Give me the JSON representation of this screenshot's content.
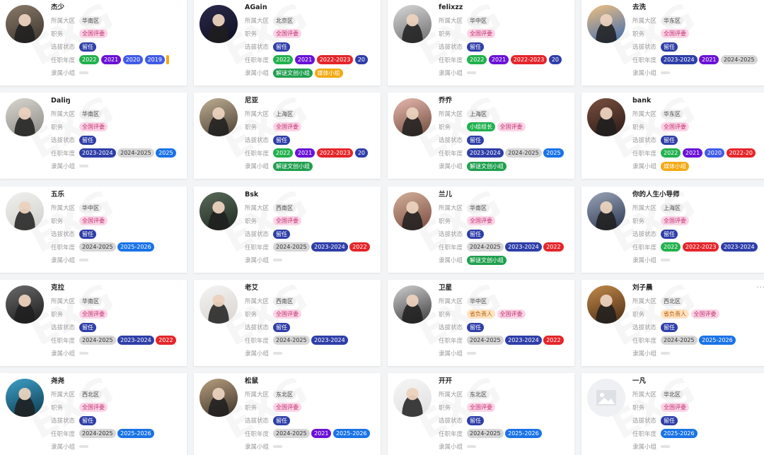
{
  "labels": {
    "region": "所属大区",
    "position": "职务",
    "status": "选拔状态",
    "years": "任职年度",
    "group": "隶属小组"
  },
  "colors": {
    "region": "#eeeeee",
    "position": "#fbd5e7",
    "status": "#2e3ea8",
    "green": "#22b14c",
    "purple": "#6a11d6",
    "red": "#e5252a",
    "blue": "#3f5be8",
    "gray": "#d6d6d6",
    "sky": "#1a73e8",
    "gold": "#f3a912"
  },
  "cards": [
    {
      "name": "杰少",
      "region": "华南区",
      "positions": [
        {
          "text": "全国评委",
          "style": "pos"
        }
      ],
      "status": "留任",
      "years": [
        {
          "text": "2022",
          "style": "green"
        },
        {
          "text": "2021",
          "style": "purple"
        },
        {
          "text": "2020",
          "style": "blue"
        },
        {
          "text": "2019",
          "style": "blue"
        },
        {
          "text": "",
          "style": "gold"
        }
      ],
      "groups": []
    },
    {
      "name": "AGain",
      "region": "北京区",
      "positions": [
        {
          "text": "全国评委",
          "style": "pos"
        }
      ],
      "status": "留任",
      "years": [
        {
          "text": "2022",
          "style": "green"
        },
        {
          "text": "2021",
          "style": "purple"
        },
        {
          "text": "2022-2023",
          "style": "red"
        },
        {
          "text": "20",
          "style": "navy"
        }
      ],
      "groups": [
        {
          "text": "解谜文创小组",
          "style": "dgreen"
        },
        {
          "text": "媒体小组",
          "style": "gold"
        }
      ]
    },
    {
      "name": "felixzz",
      "region": "华中区",
      "positions": [
        {
          "text": "全国评委",
          "style": "pos"
        }
      ],
      "status": "留任",
      "years": [
        {
          "text": "2022",
          "style": "green"
        },
        {
          "text": "2021",
          "style": "purple"
        },
        {
          "text": "2022-2023",
          "style": "red"
        },
        {
          "text": "20",
          "style": "navy"
        }
      ],
      "groups": []
    },
    {
      "name": "去洗",
      "region": "华东区",
      "positions": [
        {
          "text": "全国评委",
          "style": "pos"
        }
      ],
      "status": "留任",
      "years": [
        {
          "text": "2023-2024",
          "style": "navy"
        },
        {
          "text": "2021",
          "style": "purple"
        },
        {
          "text": "2024-2025",
          "style": "gray"
        }
      ],
      "groups": []
    },
    {
      "name": "Daliŋ",
      "region": "华南区",
      "positions": [
        {
          "text": "全国评委",
          "style": "pos"
        }
      ],
      "status": "留任",
      "years": [
        {
          "text": "2023-2024",
          "style": "navy"
        },
        {
          "text": "2024-2025",
          "style": "gray"
        },
        {
          "text": "2025",
          "style": "sky"
        }
      ],
      "groups": []
    },
    {
      "name": "尼亚",
      "region": "上海区",
      "positions": [
        {
          "text": "全国评委",
          "style": "pos"
        }
      ],
      "status": "留任",
      "years": [
        {
          "text": "2022",
          "style": "green"
        },
        {
          "text": "2021",
          "style": "purple"
        },
        {
          "text": "2022-2023",
          "style": "red"
        },
        {
          "text": "20",
          "style": "navy"
        }
      ],
      "groups": [
        {
          "text": "解谜文创小组",
          "style": "dgreen"
        }
      ]
    },
    {
      "name": "乔乔",
      "region": "上海区",
      "positions": [
        {
          "text": "小组组长",
          "style": "lead"
        },
        {
          "text": "全国评委",
          "style": "pos"
        }
      ],
      "status": "留任",
      "years": [
        {
          "text": "2023-2024",
          "style": "navy"
        },
        {
          "text": "2024-2025",
          "style": "gray"
        },
        {
          "text": "2025",
          "style": "sky"
        }
      ],
      "groups": [
        {
          "text": "解谜文创小组",
          "style": "dgreen"
        }
      ]
    },
    {
      "name": "bank",
      "region": "华东区",
      "positions": [
        {
          "text": "全国评委",
          "style": "pos"
        }
      ],
      "status": "留任",
      "years": [
        {
          "text": "2022",
          "style": "green"
        },
        {
          "text": "2021",
          "style": "purple"
        },
        {
          "text": "2020",
          "style": "blue"
        },
        {
          "text": "2022-20",
          "style": "red"
        }
      ],
      "groups": [
        {
          "text": "媒体小组",
          "style": "gold"
        }
      ]
    },
    {
      "name": "五乐",
      "region": "华中区",
      "positions": [
        {
          "text": "全国评委",
          "style": "pos"
        }
      ],
      "status": "留任",
      "years": [
        {
          "text": "2024-2025",
          "style": "gray"
        },
        {
          "text": "2025-2026",
          "style": "sky"
        }
      ],
      "groups": []
    },
    {
      "name": "Bsk",
      "region": "西南区",
      "positions": [
        {
          "text": "全国评委",
          "style": "pos"
        }
      ],
      "status": "留任",
      "years": [
        {
          "text": "2024-2025",
          "style": "gray"
        },
        {
          "text": "2023-2024",
          "style": "navy"
        },
        {
          "text": "2022",
          "style": "red"
        }
      ],
      "groups": []
    },
    {
      "name": "兰儿",
      "region": "华南区",
      "positions": [
        {
          "text": "全国评委",
          "style": "pos"
        }
      ],
      "status": "留任",
      "years": [
        {
          "text": "2024-2025",
          "style": "gray"
        },
        {
          "text": "2023-2024",
          "style": "navy"
        },
        {
          "text": "2022",
          "style": "red"
        }
      ],
      "groups": [
        {
          "text": "解谜文创小组",
          "style": "dgreen"
        }
      ]
    },
    {
      "name": "你的人生小导师",
      "region": "上海区",
      "positions": [
        {
          "text": "全国评委",
          "style": "pos"
        }
      ],
      "status": "留任",
      "years": [
        {
          "text": "2022",
          "style": "green"
        },
        {
          "text": "2022-2023",
          "style": "red"
        },
        {
          "text": "2023-2024",
          "style": "navy"
        }
      ],
      "groups": []
    },
    {
      "name": "克拉",
      "region": "华南区",
      "positions": [
        {
          "text": "全国评委",
          "style": "pos"
        }
      ],
      "status": "留任",
      "years": [
        {
          "text": "2024-2025",
          "style": "gray"
        },
        {
          "text": "2023-2024",
          "style": "navy"
        },
        {
          "text": "2022",
          "style": "red"
        }
      ],
      "groups": []
    },
    {
      "name": "老艾",
      "region": "西南区",
      "positions": [
        {
          "text": "全国评委",
          "style": "pos"
        }
      ],
      "status": "留任",
      "years": [
        {
          "text": "2024-2025",
          "style": "gray"
        },
        {
          "text": "2023-2024",
          "style": "navy"
        }
      ],
      "groups": []
    },
    {
      "name": "卫星",
      "region": "华中区",
      "positions": [
        {
          "text": "省负责人",
          "style": "pos2"
        },
        {
          "text": "全国评委",
          "style": "pos"
        }
      ],
      "status": "留任",
      "years": [
        {
          "text": "2024-2025",
          "style": "gray"
        },
        {
          "text": "2023-2024",
          "style": "navy"
        },
        {
          "text": "2022",
          "style": "red"
        }
      ],
      "groups": []
    },
    {
      "name": "刘子晨",
      "region": "西北区",
      "positions": [
        {
          "text": "省负责人",
          "style": "pos2"
        },
        {
          "text": "全国评委",
          "style": "pos"
        }
      ],
      "status": "留任",
      "years": [
        {
          "text": "2024-2025",
          "style": "gray"
        },
        {
          "text": "2025-2026",
          "style": "sky"
        }
      ],
      "groups": [],
      "more": "···"
    },
    {
      "name": "尧尧",
      "region": "西北区",
      "positions": [
        {
          "text": "全国评委",
          "style": "pos"
        }
      ],
      "status": "留任",
      "years": [
        {
          "text": "2024-2025",
          "style": "gray"
        },
        {
          "text": "2025-2026",
          "style": "sky"
        }
      ],
      "groups": []
    },
    {
      "name": "松鼠",
      "region": "东北区",
      "positions": [
        {
          "text": "全国评委",
          "style": "pos"
        }
      ],
      "status": "留任",
      "years": [
        {
          "text": "2024-2025",
          "style": "gray"
        },
        {
          "text": "2021",
          "style": "purple"
        },
        {
          "text": "2025-2026",
          "style": "sky"
        }
      ],
      "groups": []
    },
    {
      "name": "开开",
      "region": "东北区",
      "positions": [
        {
          "text": "全国评委",
          "style": "pos"
        }
      ],
      "status": "留任",
      "years": [
        {
          "text": "2024-2025",
          "style": "gray"
        },
        {
          "text": "2025-2026",
          "style": "sky"
        }
      ],
      "groups": []
    },
    {
      "name": "一凡",
      "region": "华北区",
      "positions": [
        {
          "text": "全国评委",
          "style": "pos"
        }
      ],
      "status": "留任",
      "years": [
        {
          "text": "2025-2026",
          "style": "sky"
        }
      ],
      "groups": [],
      "placeholder_avatar": true
    }
  ],
  "watermark": "EXG"
}
